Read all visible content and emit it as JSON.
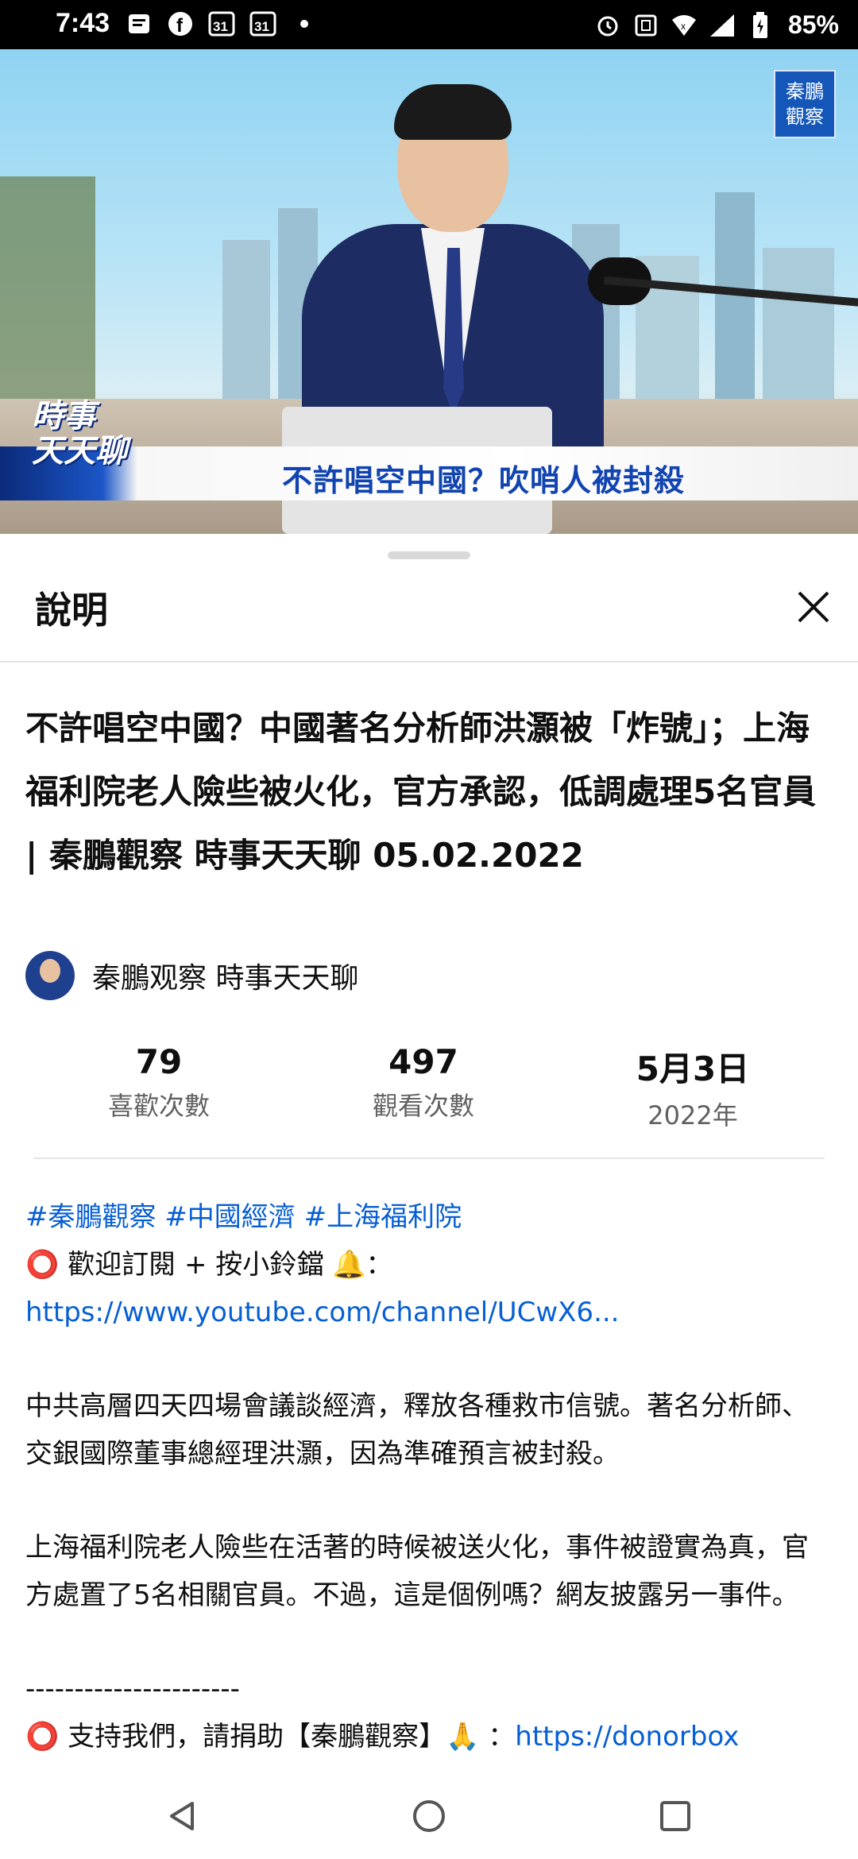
{
  "status_bar": {
    "time": "7:43",
    "left_icons": [
      "message-icon",
      "facebook-icon",
      "calendar-31-icon",
      "calendar-31-icon",
      "dot-icon"
    ],
    "right_icons": [
      "alarm-icon",
      "nfc-icon",
      "wifi-icon",
      "signal-icon",
      "battery-icon"
    ],
    "battery": "85%"
  },
  "video": {
    "logo_text": "秦鵬觀察",
    "show_name_line1": "時事",
    "show_name_line2": "天天聊",
    "headline": "不許唱空中國？吹哨人被封殺",
    "progress_fraction": 0.03
  },
  "sheet": {
    "title": "說明",
    "close_icon": "close-icon"
  },
  "video_info": {
    "title": "不許唱空中國？中國著名分析師洪灝被「炸號」；上海福利院老人險些被火化，官方承認，低調處理5名官員 | 秦鵬觀察 時事天天聊 05.02.2022",
    "channel_name": "秦鵬观察 時事天天聊"
  },
  "stats": {
    "likes_value": "79",
    "likes_label": "喜歡次數",
    "views_value": "497",
    "views_label": "觀看次數",
    "date_value": "5月3日",
    "date_year": "2022年"
  },
  "description": {
    "hashtags": "#秦鵬觀察 #中國經濟 #上海福利院",
    "subscribe_text": " 歡迎訂閱 + 按小鈴鐺 🔔：",
    "subscribe_link": "https://www.youtube.com/channel/UCwX6...",
    "para1": "中共高層四天四場會議談經濟，釋放各種救市信號。著名分析師、交銀國際董事總經理洪灝，因為準確預言被封殺。",
    "para2": "上海福利院老人險些在活著的時候被送火化，事件被證實為真，官方處置了5名相關官員。不過，這是個例嗎？網友披露另一事件。",
    "divider": "----------------------",
    "support_text": " 支持我們，請捐助【秦鵬觀察】🙏 ：",
    "support_link": "https://donorbox",
    "circle_symbol": "⭕"
  },
  "nav_bar": {
    "back": "back-icon",
    "home": "home-icon",
    "recents": "recents-icon"
  }
}
